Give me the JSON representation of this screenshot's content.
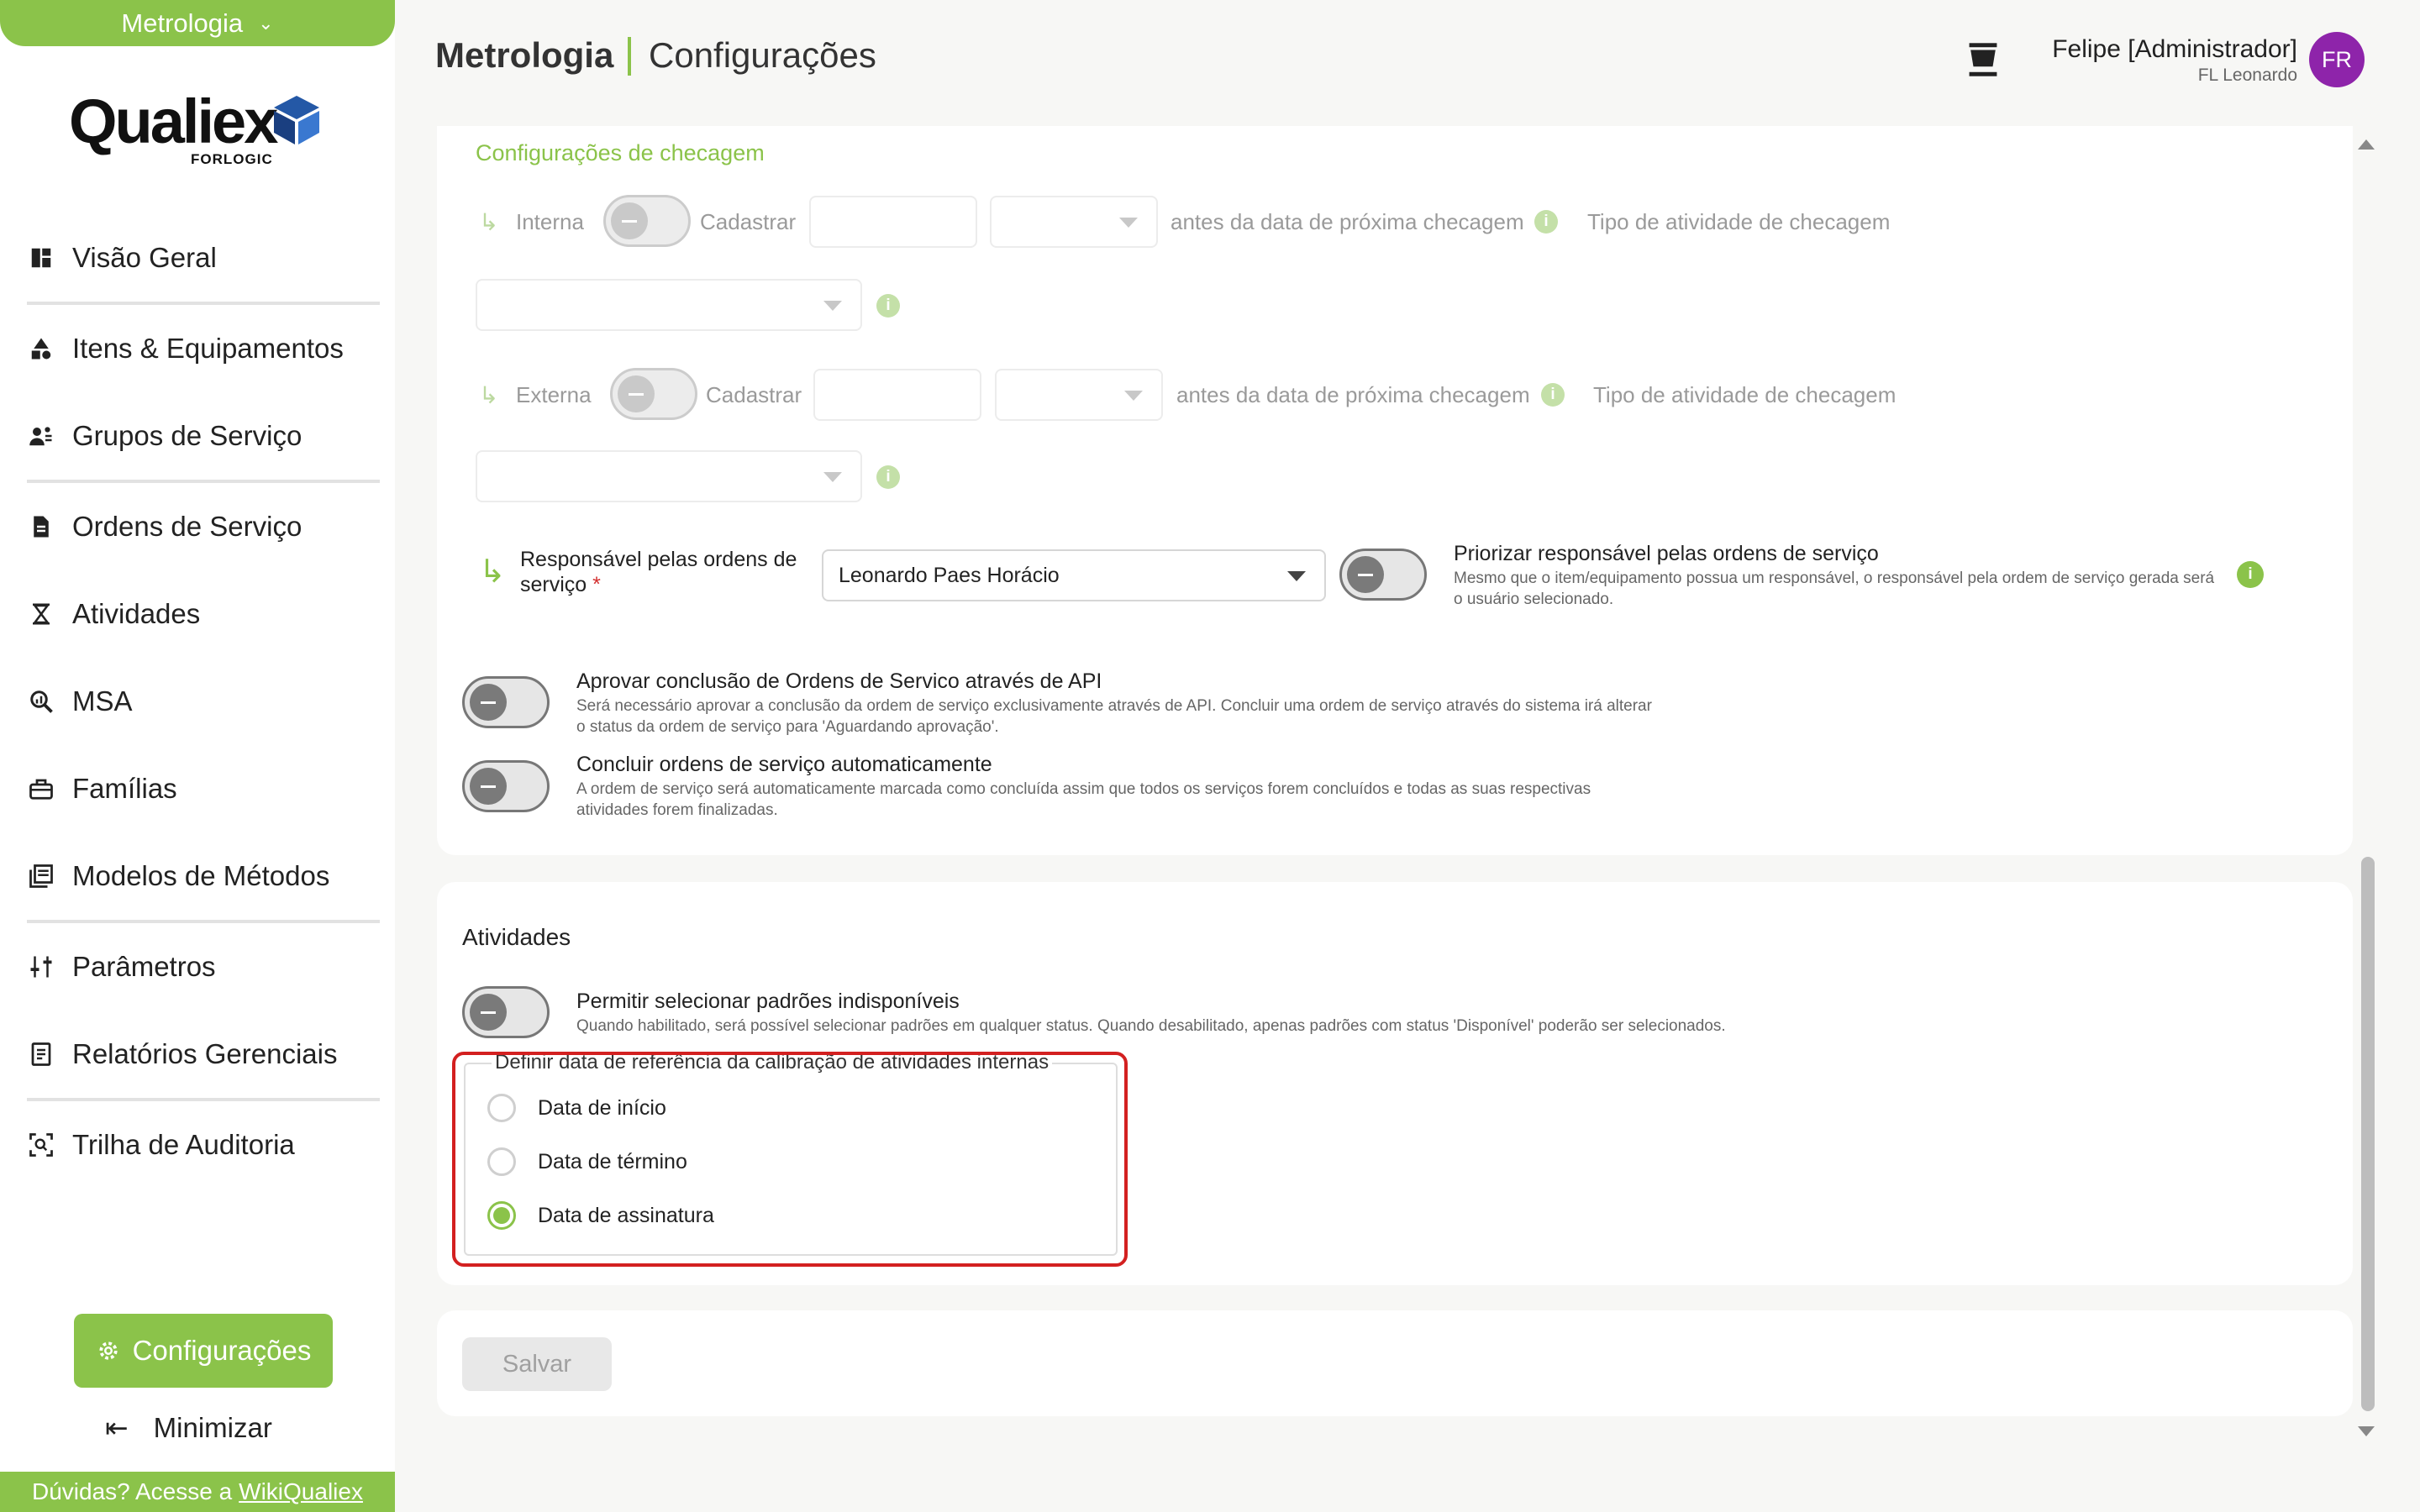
{
  "sidebar": {
    "module": "Metrologia",
    "logo": {
      "name": "Qualiex",
      "sub": "FORLOGIC"
    },
    "items": [
      {
        "label": "Visão Geral",
        "icon": "dashboard-icon"
      },
      {
        "label": "Itens & Equipamentos",
        "icon": "shapes-icon"
      },
      {
        "label": "Grupos de Serviço",
        "icon": "user-group-icon"
      },
      {
        "label": "Ordens de Serviço",
        "icon": "document-icon"
      },
      {
        "label": "Atividades",
        "icon": "hourglass-icon"
      },
      {
        "label": "MSA",
        "icon": "magnify-chart-icon"
      },
      {
        "label": "Famílias",
        "icon": "toolbox-icon"
      },
      {
        "label": "Modelos de Métodos",
        "icon": "library-icon"
      },
      {
        "label": "Parâmetros",
        "icon": "sliders-icon"
      },
      {
        "label": "Relatórios Gerenciais",
        "icon": "report-icon"
      },
      {
        "label": "Trilha de Auditoria",
        "icon": "audit-icon"
      }
    ],
    "config_button": "Configurações",
    "minimize": "Minimizar",
    "help_prefix": "Dúvidas? Acesse a",
    "help_link": "WikiQualiex"
  },
  "header": {
    "module": "Metrologia",
    "page": "Configurações",
    "user_name": "Felipe [Administrador]",
    "user_company": "FL Leonardo",
    "avatar_initials": "FR"
  },
  "checagem": {
    "title": "Configurações de checagem",
    "internal": {
      "label": "Interna",
      "register": "Cadastrar",
      "before_text": "antes da data de próxima checagem",
      "activity_type": "Tipo de atividade de checagem"
    },
    "external": {
      "label": "Externa",
      "register": "Cadastrar",
      "before_text": "antes da data de próxima checagem",
      "activity_type": "Tipo de atividade de checagem"
    },
    "responsible": {
      "label": "Responsável pelas ordens de serviço",
      "required_mark": "*",
      "value": "Leonardo Paes Horácio"
    },
    "prioritize": {
      "title": "Priorizar responsável pelas ordens de serviço",
      "desc": "Mesmo que o item/equipamento possua um responsável, o responsável pela ordem de serviço gerada será o usuário selecionado."
    },
    "approve_api": {
      "title": "Aprovar conclusão de Ordens de Servico através de API",
      "desc": "Será necessário aprovar a conclusão da ordem de serviço exclusivamente através de API. Concluir uma ordem de serviço através do sistema irá alterar o status da ordem de serviço para 'Aguardando aprovação'."
    },
    "auto_complete": {
      "title": "Concluir ordens de serviço automaticamente",
      "desc": "A ordem de serviço será automaticamente marcada como concluída assim que todos os serviços forem concluídos e todas as suas respectivas atividades forem finalizadas."
    }
  },
  "atividades": {
    "title": "Atividades",
    "allow_unavailable": {
      "title": "Permitir selecionar padrões indisponíveis",
      "desc": "Quando habilitado, será possível selecionar padrões em qualquer status. Quando desabilitado, apenas padrões com status 'Disponível' poderão ser selecionados."
    },
    "reference_date": {
      "legend": "Definir data de referência da calibração de atividades internas",
      "options": [
        {
          "label": "Data de início",
          "selected": false
        },
        {
          "label": "Data de término",
          "selected": false
        },
        {
          "label": "Data de assinatura",
          "selected": true
        }
      ]
    }
  },
  "footer": {
    "save_label": "Salvar"
  },
  "colors": {
    "accent": "#8bc34a",
    "highlight": "#d32020",
    "avatar": "#8e24aa"
  }
}
